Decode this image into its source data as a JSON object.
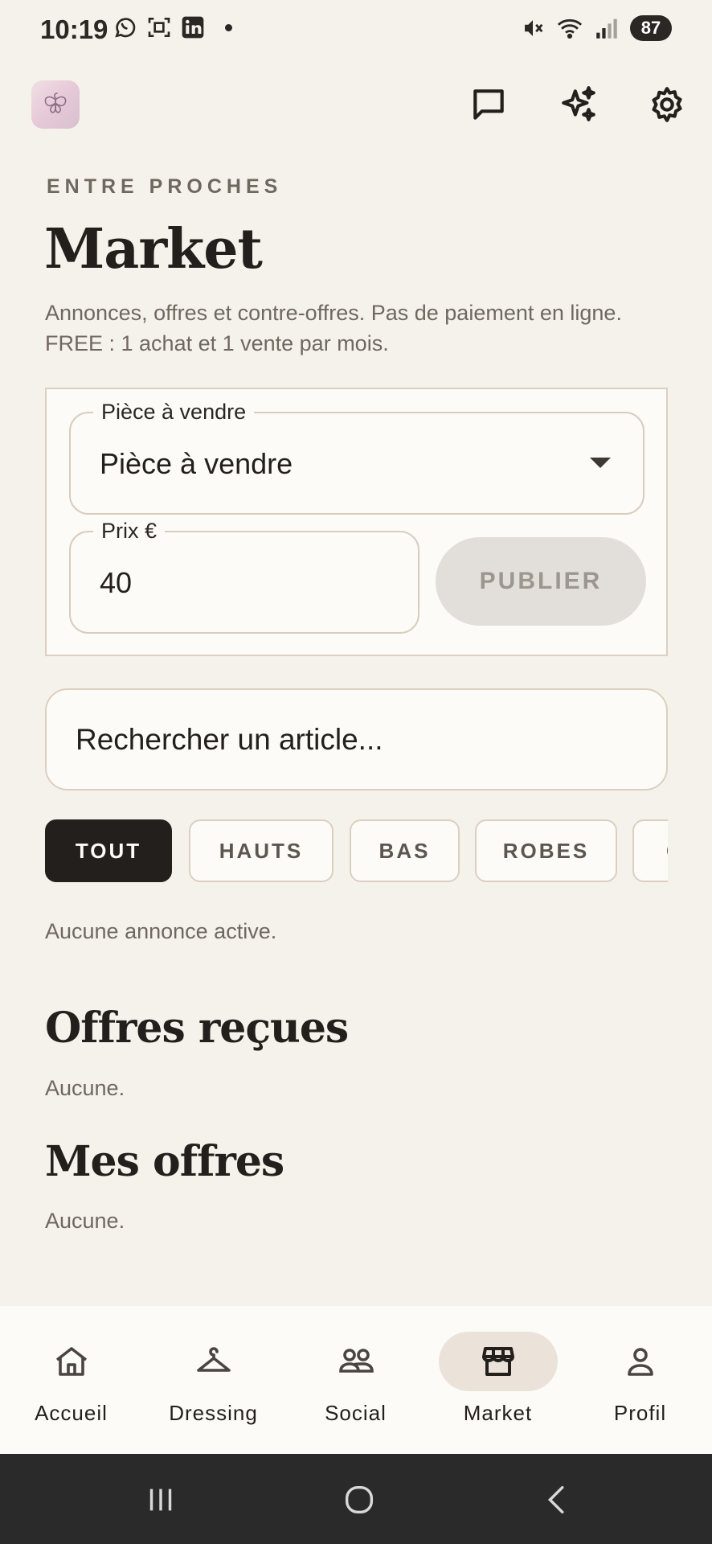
{
  "status_bar": {
    "time": "10:19",
    "battery": "87",
    "left_icons": [
      "whatsapp-icon",
      "screenshot-icon",
      "linkedin-icon"
    ],
    "right_icons": [
      "mute-icon",
      "wifi-icon",
      "signal-icon"
    ]
  },
  "app_bar": {
    "actions": [
      "chat-icon",
      "sparkles-icon",
      "gear-icon"
    ]
  },
  "header": {
    "eyebrow": "ENTRE PROCHES",
    "title": "Market",
    "subtitle": "Annonces, offres et contre-offres. Pas de paiement en ligne. FREE : 1 achat et 1 vente par mois."
  },
  "sell_form": {
    "item_label": "Pièce à vendre",
    "item_value": "Pièce à vendre",
    "price_label": "Prix €",
    "price_value": "40",
    "publish_label": "PUBLIER"
  },
  "search": {
    "placeholder": "Rechercher un article..."
  },
  "filters": [
    {
      "label": "TOUT",
      "active": true
    },
    {
      "label": "HAUTS",
      "active": false
    },
    {
      "label": "BAS",
      "active": false
    },
    {
      "label": "ROBES",
      "active": false
    },
    {
      "label": "C",
      "active": false
    }
  ],
  "listings": {
    "empty_text": "Aucune annonce active."
  },
  "offers_received": {
    "title": "Offres reçues",
    "empty_text": "Aucune."
  },
  "my_offers": {
    "title": "Mes offres",
    "empty_text": "Aucune."
  },
  "bottom_nav": {
    "items": [
      {
        "label": "Accueil",
        "icon": "home-icon",
        "active": false
      },
      {
        "label": "Dressing",
        "icon": "hanger-icon",
        "active": false
      },
      {
        "label": "Social",
        "icon": "people-icon",
        "active": false
      },
      {
        "label": "Market",
        "icon": "store-icon",
        "active": true
      },
      {
        "label": "Profil",
        "icon": "person-icon",
        "active": false
      }
    ]
  },
  "colors": {
    "background": "#f5f2ec",
    "card": "#fdfbf7",
    "text": "#231f1c",
    "muted": "#6f685f",
    "border": "#dccfc0",
    "active_chip": "#231f1c",
    "nav_active_pill": "#ebe3da"
  }
}
